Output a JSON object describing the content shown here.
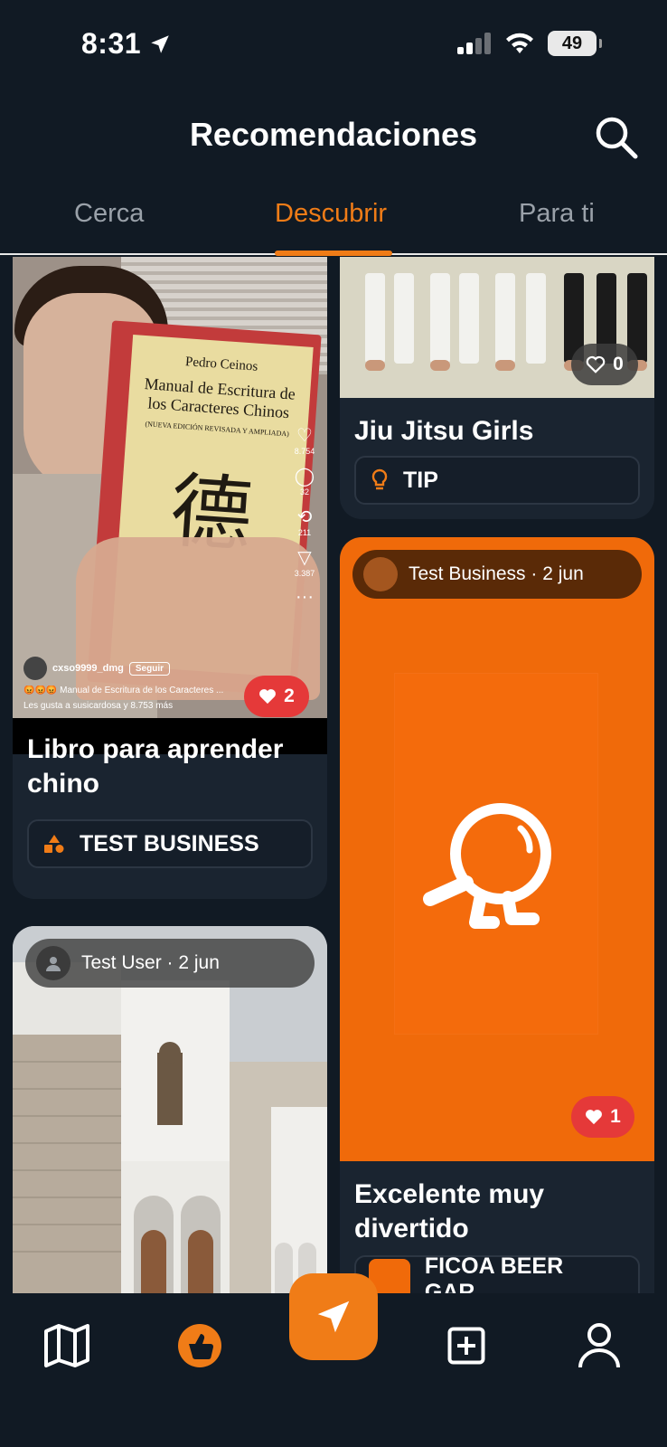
{
  "status_bar": {
    "time": "8:31",
    "battery": "49"
  },
  "header": {
    "title": "Recomendaciones"
  },
  "tabs": [
    {
      "label": "Cerca",
      "active": false
    },
    {
      "label": "Descubrir",
      "active": true
    },
    {
      "label": "Para ti",
      "active": false
    }
  ],
  "colors": {
    "accent": "#f07c17",
    "background": "#111a24",
    "card": "#1a2430",
    "like_red": "#e53939"
  },
  "feed": {
    "book_card": {
      "title": "Libro para aprender chino",
      "likes": "2",
      "tag_label": "TEST BUSINESS",
      "tag_icon": "shapes-icon",
      "photo": {
        "book_author": "Pedro Ceinos",
        "book_title": "Manual de Escritura de los Caracteres Chinos",
        "book_subtitle": "(NUEVA EDICIÓN REVISADA Y AMPLIADA)",
        "book_character": "德",
        "video_stats": [
          "8.754",
          "32",
          "211",
          "3.387"
        ],
        "video_user": "cxso9999_dmg",
        "video_follow": "Seguir",
        "video_caption": "😡😡😡 Manual de Escritura de los Caracteres ...",
        "video_likes_line": "Les gusta a susicardosa y 8.753 más"
      }
    },
    "jiu_card": {
      "title": "Jiu Jitsu Girls",
      "likes": "0",
      "tag_label": "TIP",
      "tag_icon": "lightbulb-icon"
    },
    "biz_card": {
      "author": "Test Business · 2 jun",
      "likes": "1",
      "title": "Excelente muy divertido",
      "tag_label": "FICOA BEER GAR..."
    },
    "church_card": {
      "author": "Test User · 2 jun"
    }
  },
  "bottom_nav": [
    {
      "icon": "map-icon"
    },
    {
      "icon": "recommendations-icon",
      "active": true
    },
    {
      "icon": "navigate-icon"
    },
    {
      "icon": "add-icon"
    },
    {
      "icon": "profile-icon"
    }
  ]
}
